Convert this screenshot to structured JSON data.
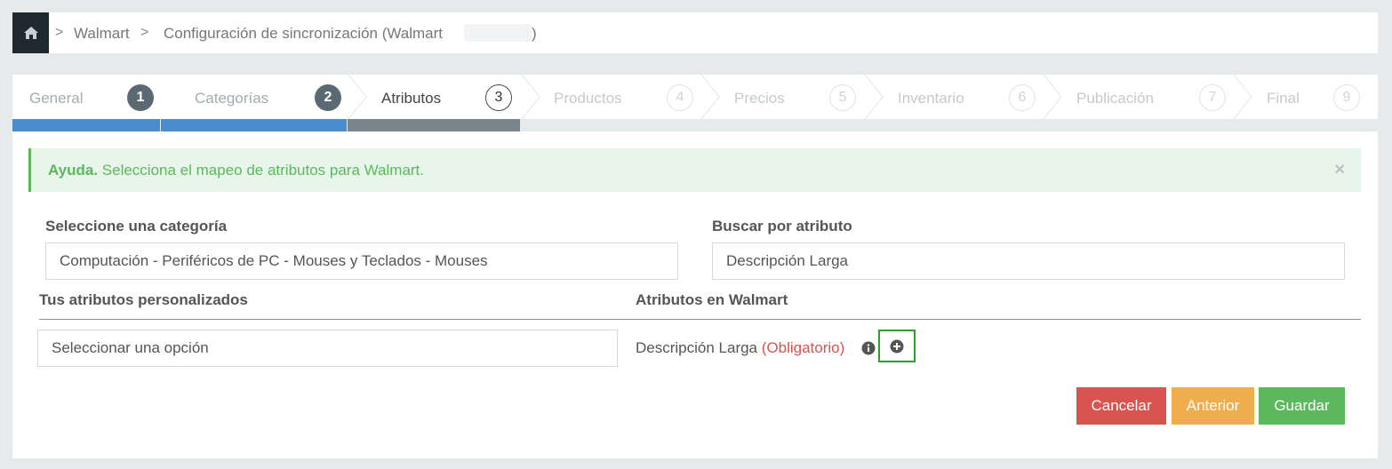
{
  "breadcrumb": {
    "items": [
      "Walmart",
      "Configuración de sincronización (Walmart"
    ],
    "closing": ")"
  },
  "wizard": {
    "steps": [
      {
        "label": "General",
        "number": "1",
        "state": "done"
      },
      {
        "label": "Categorías",
        "number": "2",
        "state": "done"
      },
      {
        "label": "Atributos",
        "number": "3",
        "state": "active"
      },
      {
        "label": "Productos",
        "number": "4",
        "state": "future"
      },
      {
        "label": "Precios",
        "number": "5",
        "state": "future"
      },
      {
        "label": "Inventario",
        "number": "6",
        "state": "future"
      },
      {
        "label": "Publicación",
        "number": "7",
        "state": "future"
      },
      {
        "label": "Final",
        "number": "9",
        "state": "future"
      }
    ]
  },
  "alert": {
    "title": "Ayuda.",
    "message": "Selecciona el mapeo de atributos para Walmart.",
    "close": "×"
  },
  "form": {
    "category_label": "Seleccione una categoría",
    "category_value": "Computación - Periféricos de PC - Mouses y Teclados - Mouses",
    "search_label": "Buscar por atributo",
    "search_value": "Descripción Larga",
    "custom_attrs_label": "Tus atributos personalizados",
    "walmart_attrs_label": "Atributos en Walmart",
    "custom_select_value": "Seleccionar una opción",
    "attribute_name": "Descripción Larga",
    "attribute_required": "(Obligatorio)"
  },
  "buttons": {
    "cancel": "Cancelar",
    "previous": "Anterior",
    "save": "Guardar"
  },
  "colors": {
    "cancel": "#d9534f",
    "previous": "#f0ad4e",
    "save": "#5cb85c",
    "wizard_done": "#4a8ccc",
    "wizard_active": "#7a858b"
  }
}
